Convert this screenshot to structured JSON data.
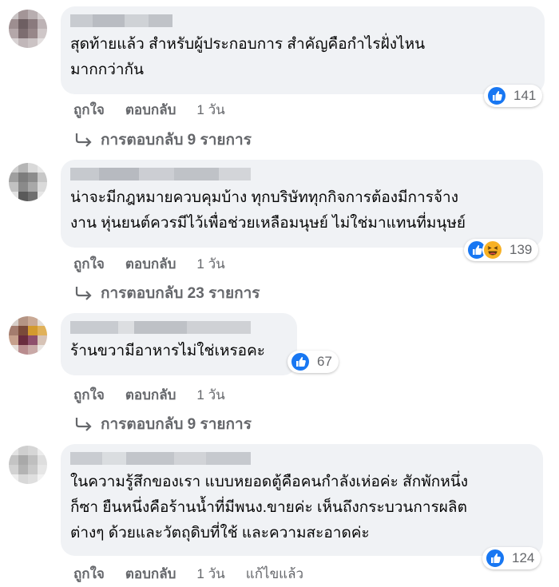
{
  "colors": {
    "bubble_bg": "#f0f2f5",
    "muted_text": "#65676b",
    "like_blue": "#1877f2",
    "haha_yellow": "#f7b125"
  },
  "action_labels": {
    "like": "ถูกใจ",
    "reply": "ตอบกลับ",
    "edited": "แก้ไขแล้ว"
  },
  "comments": [
    {
      "text_lines": [
        "สุดท้ายแล้ว สำหรับผู้ประกอบการ สำคัญคือกำไรฝั่งไหน",
        "มากกว่ากัน"
      ],
      "time": "1 วัน",
      "replies": "การตอบกลับ 9 รายการ",
      "reactions": [
        "like-icon"
      ],
      "reaction_count": "141"
    },
    {
      "text_lines": [
        "น่าจะมีกฎหมายควบคุมบ้าง ทุกบริษัททุกกิจการต้องมีการจ้าง",
        "งาน หุ่นยนต์ควรมีไว้เพื่อช่วยเหลือมนุษย์ ไม่ใช่มาแทนที่มนุษย์"
      ],
      "time": "1 วัน",
      "replies": "การตอบกลับ 23 รายการ",
      "reactions": [
        "like-icon",
        "haha-icon"
      ],
      "reaction_count": "139"
    },
    {
      "text_lines": [
        "ร้านขวามีอาหารไม่ใช่เหรอคะ"
      ],
      "time": "1 วัน",
      "replies": "การตอบกลับ 9 รายการ",
      "reactions": [
        "like-icon"
      ],
      "reaction_count": "67"
    },
    {
      "text_lines": [
        "ในความรู้สึกของเรา แบบหยอดตู้คือคนกำลังเห่อค่ะ สักพักหนึ่ง",
        "ก็ซา ยืนหนึ่งคือร้านน้ำที่มีพนง.ขายค่ะ เห็นถึงกระบวนการผลิต",
        "ต่างๆ ด้วยและวัตถุดิบที่ใช้ และความสะอาดค่ะ"
      ],
      "time": "1 วัน",
      "reactions": [
        "like-icon"
      ],
      "reaction_count": "124"
    }
  ]
}
